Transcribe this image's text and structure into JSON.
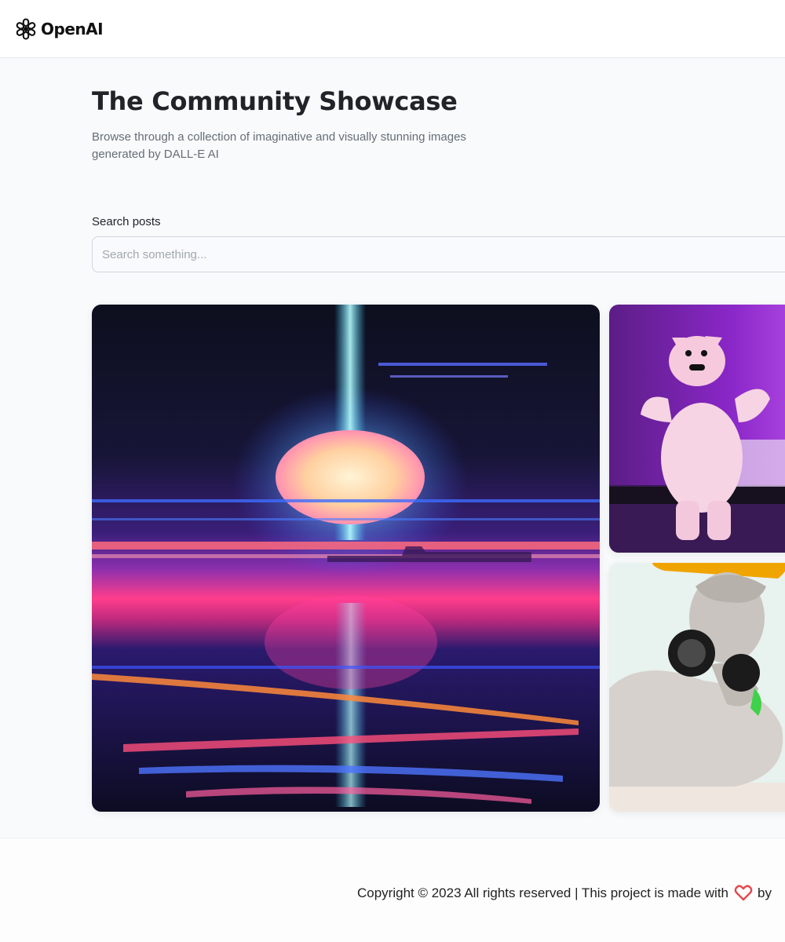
{
  "header": {
    "logo_text": "OpenAI",
    "logo_icon": "openai-logo-icon"
  },
  "hero": {
    "title": "The Community Showcase",
    "subtitle": "Browse through a collection of imaginative and visually stunning images generated by DALL-E AI"
  },
  "search": {
    "label": "Search posts",
    "placeholder": "Search something...",
    "value": ""
  },
  "gallery": {
    "items": [
      {
        "subject": "synthwave-sunset-ocean"
      },
      {
        "subject": "pink-yeti-dancing"
      },
      {
        "subject": "greek-statue-with-headphones"
      }
    ]
  },
  "footer": {
    "text_before": "Copyright © 2023 All rights reserved | This project is made with",
    "heart_icon": "heart-icon",
    "text_after": "by"
  },
  "colors": {
    "heart": "#e5484d",
    "title": "#222328",
    "subtitle": "#666e75"
  }
}
